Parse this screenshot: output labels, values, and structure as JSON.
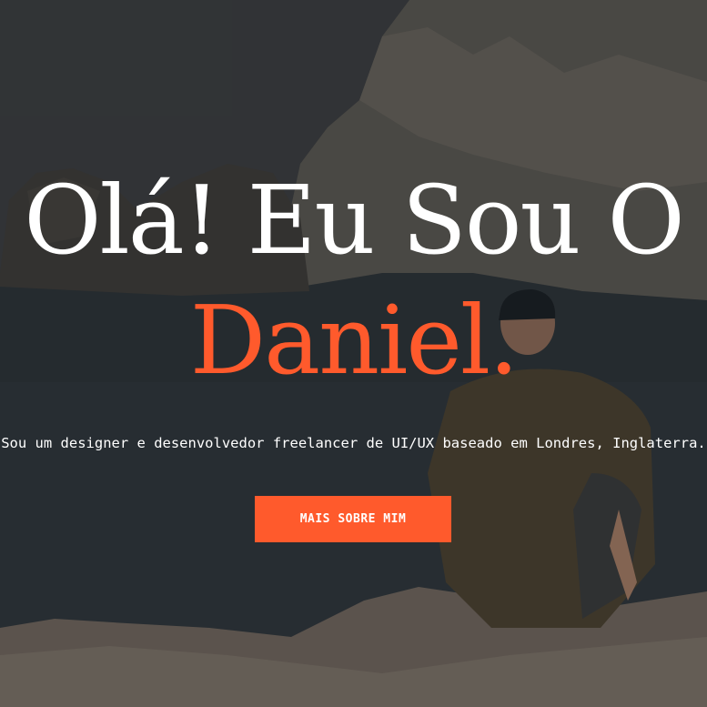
{
  "hero": {
    "headline": "Olá! Eu Sou O",
    "name": "Daniel.",
    "intro": "Sou um designer e desenvolvedor freelancer de UI/UX baseado em Londres, Inglaterra.",
    "cta_label": "MAIS SOBRE MIM"
  },
  "colors": {
    "accent": "#ff5a2c",
    "text": "#ffffff"
  }
}
